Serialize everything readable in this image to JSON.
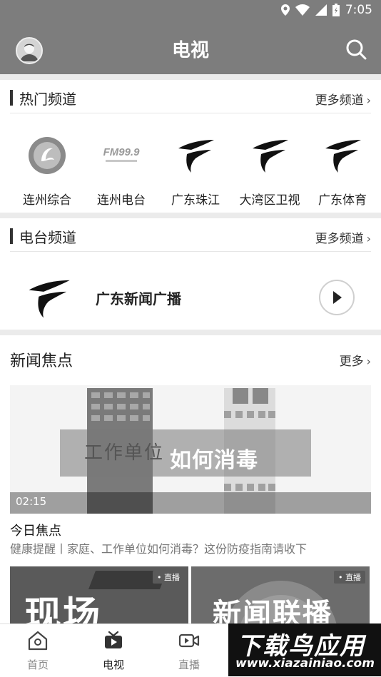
{
  "status_bar": {
    "time": "7:05"
  },
  "header": {
    "title": "电视"
  },
  "hot_channels": {
    "title": "热门频道",
    "more": "更多频道",
    "items": [
      {
        "name": "连州综合",
        "logo": "lianzhou-tv-logo"
      },
      {
        "name": "连州电台",
        "logo": "fm99-logo",
        "logo_text": "FM99.9"
      },
      {
        "name": "广东珠江",
        "logo": "gdtv-logo"
      },
      {
        "name": "大湾区卫视",
        "logo": "gdtv-logo"
      },
      {
        "name": "广东体育",
        "logo": "gdtv-logo"
      }
    ]
  },
  "radio_channels": {
    "title": "电台频道",
    "more": "更多频道",
    "item": {
      "name": "广东新闻广播",
      "logo": "gdtv-logo"
    }
  },
  "news": {
    "title": "新闻焦点",
    "more": "更多",
    "feature": {
      "duration": "02:15",
      "overlay_text_1": "工作单位",
      "overlay_text_2": "如何消毒",
      "title": "今日焦点",
      "subtitle": "健康提醒丨家庭、工作单位如何消毒？这份防疫指南请收下"
    },
    "thumbnails": [
      {
        "badge": "• 直播",
        "text": "现场"
      },
      {
        "badge": "• 直播",
        "text": "新闻联播"
      }
    ]
  },
  "tabbar": {
    "tabs": [
      {
        "label": "首页",
        "icon": "home-icon",
        "active": false
      },
      {
        "label": "电视",
        "icon": "tv-icon",
        "active": true
      },
      {
        "label": "直播",
        "icon": "video-icon",
        "active": false
      }
    ]
  },
  "watermark": {
    "line1": "下载鸟应用",
    "line2": "www.xiazainiao.com"
  }
}
